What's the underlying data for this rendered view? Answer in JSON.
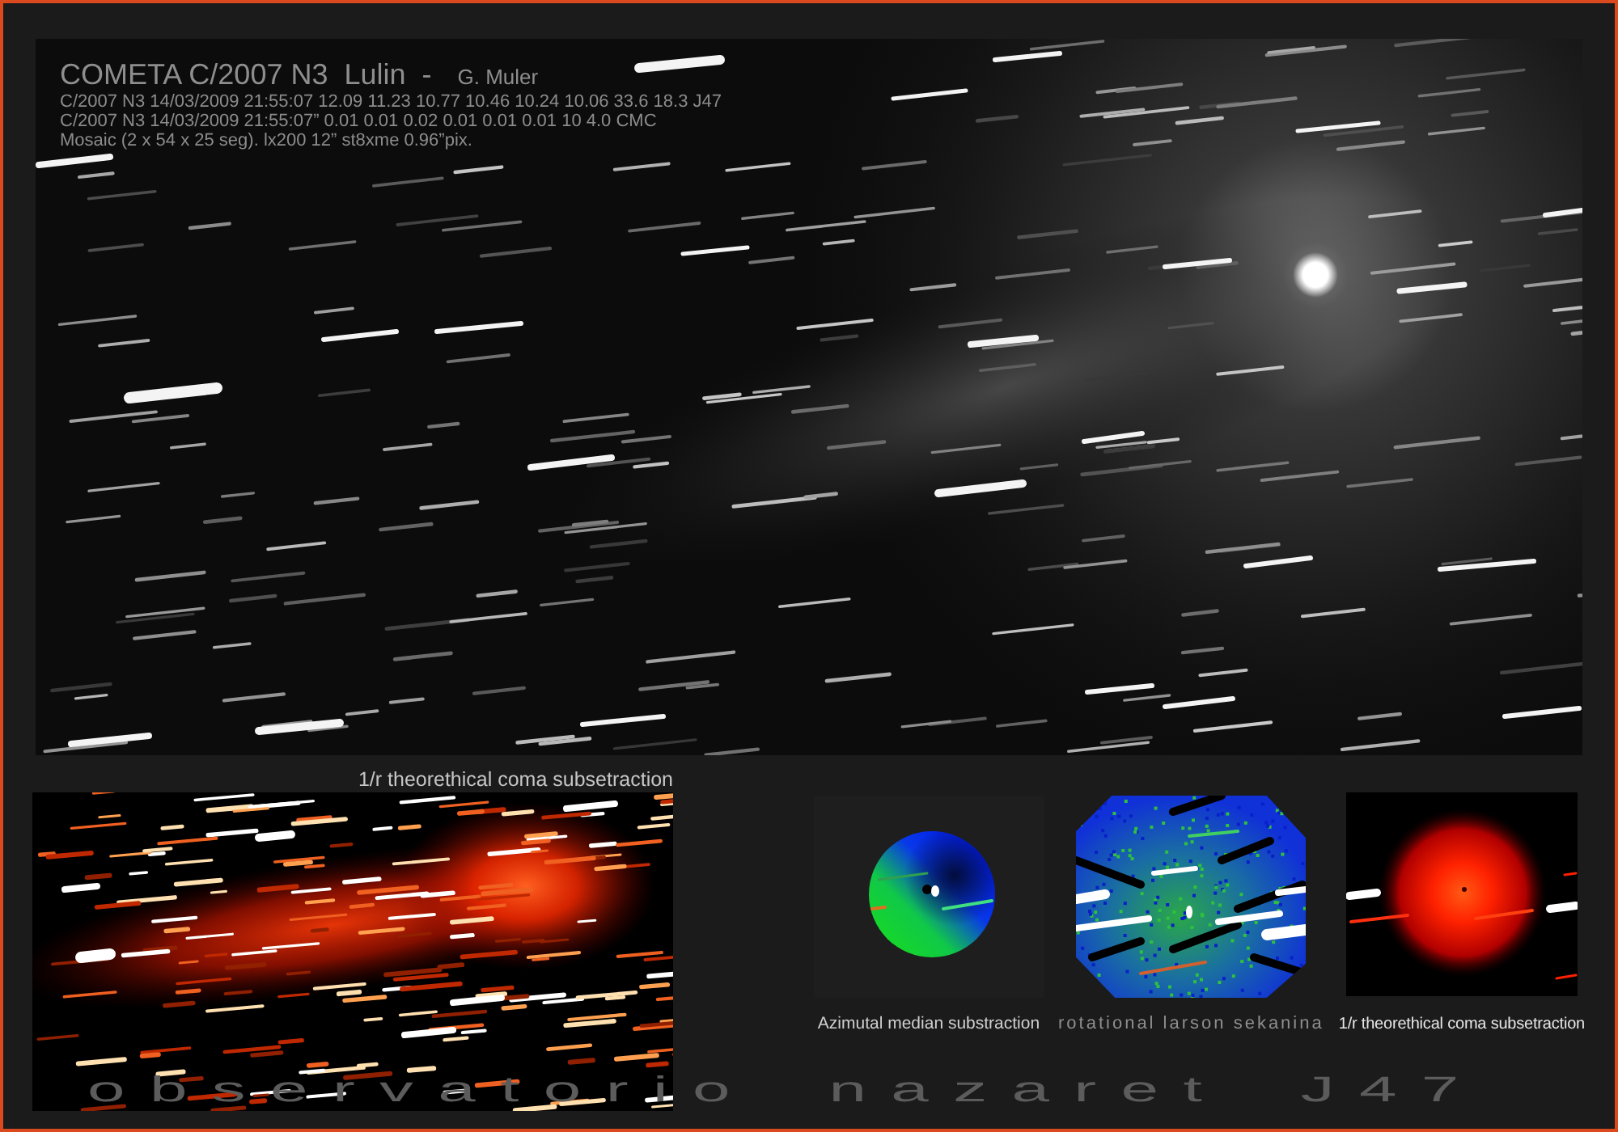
{
  "main_photo": {
    "title": "COMETA C/2007 N3  Lulin  -",
    "author": "G. Muler",
    "data_lines": [
      "C/2007 N3 14/03/2009 21:55:07 12.09 11.23 10.77 10.46 10.24 10.06 33.6 18.3 J47",
      "C/2007 N3 14/03/2009 21:55:07” 0.01 0.01 0.02 0.01 0.01 0.01 10 4.0 CMC",
      "Mosaic (2 x 54 x 25 seg). lx200 12” st8xme 0.96”pix."
    ]
  },
  "coma_photo": {
    "caption": "1/r theorethical coma subsetraction"
  },
  "processed_views": [
    {
      "kind": "azimutal",
      "caption": "Azimutal median substraction"
    },
    {
      "kind": "rotational",
      "caption": "rotational larson sekanina"
    },
    {
      "kind": "coma",
      "caption": "1/r theorethical coma subsetraction"
    }
  ],
  "signature": "observatorio nazaret J47"
}
